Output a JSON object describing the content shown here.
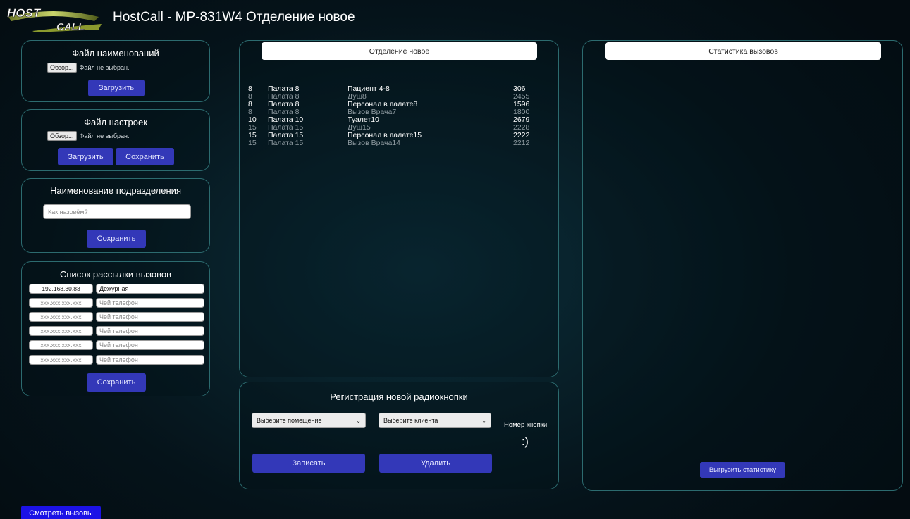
{
  "header": {
    "logo_top": "HOST",
    "logo_bottom": "CALL",
    "title": "HostCall - MP-831W4 Отделение новое"
  },
  "names_file": {
    "title": "Файл наименований",
    "browse_label": "Обзор...",
    "file_status": "Файл не выбран.",
    "upload_label": "Загрузить"
  },
  "settings_file": {
    "title": "Файл настроек",
    "browse_label": "Обзор...",
    "file_status": "Файл не выбран.",
    "upload_label": "Загрузить",
    "save_label": "Сохранить"
  },
  "division_name": {
    "title": "Наименование подразделения",
    "placeholder": "Как назовём?",
    "save_label": "Сохранить"
  },
  "distribution": {
    "title": "Список рассылки вызовов",
    "ip_placeholder": "xxx.xxx.xxx.xxx",
    "who_placeholder": "Чей телефон",
    "rows": [
      {
        "ip": "192.168.30.83",
        "who": "Дежурная"
      },
      {
        "ip": "",
        "who": ""
      },
      {
        "ip": "",
        "who": ""
      },
      {
        "ip": "",
        "who": ""
      },
      {
        "ip": "",
        "who": ""
      },
      {
        "ip": "",
        "who": ""
      }
    ],
    "save_label": "Сохранить"
  },
  "department": {
    "title": "Отделение новое",
    "calls": [
      {
        "num": "8",
        "room": "Палата 8",
        "name": "Пациент 4-8",
        "code": "306",
        "active": true
      },
      {
        "num": "8",
        "room": "Палата 8",
        "name": "Душ8",
        "code": "2455",
        "active": false
      },
      {
        "num": "8",
        "room": "Палата 8",
        "name": "Персонал в палате8",
        "code": "1596",
        "active": true
      },
      {
        "num": "8",
        "room": "Палата 8",
        "name": "Вызов Врача7",
        "code": "1800",
        "active": false
      },
      {
        "num": "10",
        "room": "Палата 10",
        "name": "Туалет10",
        "code": "2679",
        "active": true
      },
      {
        "num": "15",
        "room": "Палата 15",
        "name": "Душ15",
        "code": "2228",
        "active": false
      },
      {
        "num": "15",
        "room": "Палата 15",
        "name": "Персонал в палате15",
        "code": "2222",
        "active": true
      },
      {
        "num": "15",
        "room": "Палата 15",
        "name": "Вызов Врача14",
        "code": "2212",
        "active": false
      }
    ]
  },
  "registration": {
    "title": "Регистрация новой радиокнопки",
    "room_select": "Выберите помещение",
    "client_select": "Выберите клиента",
    "button_number_label": "Номер кнопки",
    "button_number_value": ":)",
    "record_label": "Записать",
    "delete_label": "Удалить"
  },
  "stats": {
    "title": "Статистика вызовов",
    "export_label": "Выгрузить статистику"
  },
  "footer": {
    "view_calls_label": "Смотреть вызовы"
  },
  "colors": {
    "button": "#3338b8",
    "panel_border": "#2c6b6f",
    "view_calls_button": "#1c12e6"
  }
}
